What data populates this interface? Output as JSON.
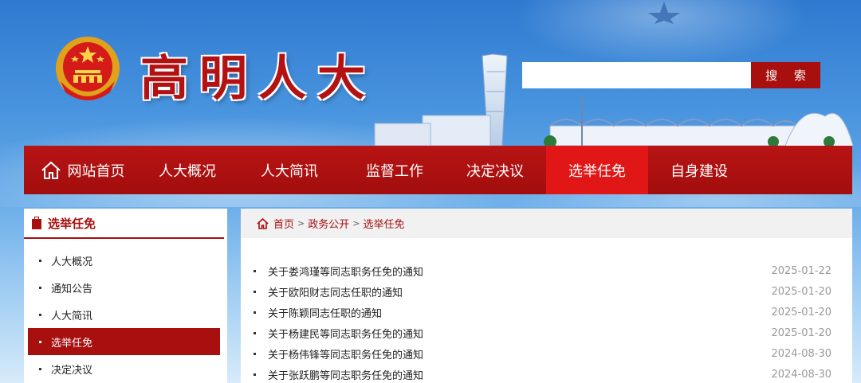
{
  "colors": {
    "brand_red": "#a80f0f",
    "nav_active": "#e11717",
    "sky": "#4a95df"
  },
  "header": {
    "site_title": "高明人大",
    "search_placeholder": "",
    "search_label": "搜 索"
  },
  "nav": {
    "items": [
      {
        "label": "网站首页",
        "icon": "home-icon"
      },
      {
        "label": "人大概况"
      },
      {
        "label": "人大简讯"
      },
      {
        "label": "监督工作"
      },
      {
        "label": "决定决议"
      },
      {
        "label": "选举任免",
        "active": true
      },
      {
        "label": "自身建设"
      }
    ]
  },
  "sidebar": {
    "title": "选举任免",
    "items": [
      {
        "label": "人大概况"
      },
      {
        "label": "通知公告"
      },
      {
        "label": "人大简讯"
      },
      {
        "label": "选举任免",
        "active": true
      },
      {
        "label": "决定决议"
      }
    ]
  },
  "breadcrumb": {
    "home": "首页",
    "sep": ">",
    "level1": "政务公开",
    "level2": "选举任免"
  },
  "news": [
    {
      "title": "关于娄鸿瑾等同志职务任免的通知",
      "date": "2025-01-22"
    },
    {
      "title": "关于欧阳财志同志任职的通知",
      "date": "2025-01-20"
    },
    {
      "title": "关于陈颖同志任职的通知",
      "date": "2025-01-20"
    },
    {
      "title": "关于杨建民等同志职务任免的通知",
      "date": "2025-01-20"
    },
    {
      "title": "关于杨伟锋等同志职务任免的通知",
      "date": "2024-08-30"
    },
    {
      "title": "关于张跃鹏等同志职务任免的通知",
      "date": "2024-08-30"
    }
  ]
}
